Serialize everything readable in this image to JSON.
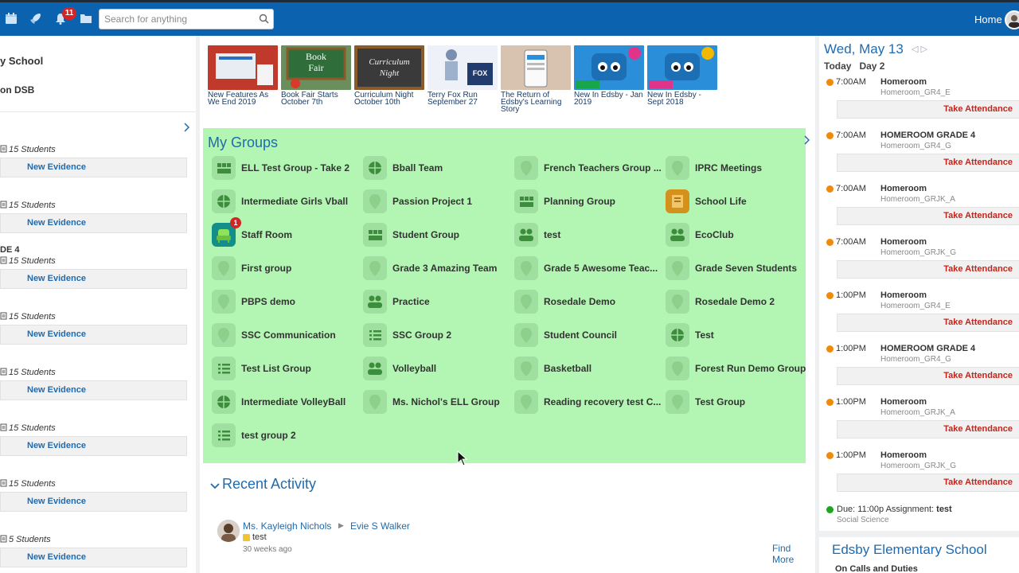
{
  "topbar": {
    "notification_count": "11",
    "search_placeholder": "Search for anything",
    "home_label": "Home"
  },
  "left": {
    "school": "y School",
    "board": "on DSB",
    "entries": [
      {
        "title": "",
        "count": "15 Students",
        "action": "New Evidence"
      },
      {
        "title": "",
        "count": "15 Students",
        "action": "New Evidence"
      },
      {
        "title": "DE 4",
        "count": "15 Students",
        "action": "New Evidence"
      },
      {
        "title": "",
        "count": "15 Students",
        "action": "New Evidence"
      },
      {
        "title": "",
        "count": "15 Students",
        "action": "New Evidence"
      },
      {
        "title": "",
        "count": "15 Students",
        "action": "New Evidence"
      },
      {
        "title": "",
        "count": "15 Students",
        "action": "New Evidence"
      },
      {
        "title": "",
        "count": "5 Students",
        "action": "New Evidence"
      }
    ]
  },
  "news": [
    {
      "caption": "New Features As We End 2019",
      "thumb": "features",
      "color": "#c0392b"
    },
    {
      "caption": "Book Fair Starts October 7th",
      "thumb": "bookfair",
      "color": "#2f6e3a"
    },
    {
      "caption": "Curriculum Night October 10th",
      "thumb": "curriculum",
      "color": "#3a3a3a"
    },
    {
      "caption": "Terry Fox Run September 27",
      "thumb": "terryfox",
      "color": "#233c6e"
    },
    {
      "caption": "The Return of Edsby's Learning Story",
      "thumb": "phone",
      "color": "#d8c3b0"
    },
    {
      "caption": "New In Edsby - Jan 2019",
      "thumb": "robot-jan",
      "color": "#2a8ed8"
    },
    {
      "caption": "New In Edsby - Sept 2018",
      "thumb": "robot-sept",
      "color": "#2a8ed8"
    }
  ],
  "groups": {
    "title": "My Groups",
    "find_more": "Find More",
    "items": [
      {
        "name": "ELL Test Group - Take 2",
        "icon": "group-icon"
      },
      {
        "name": "Bball Team",
        "icon": "ball-icon"
      },
      {
        "name": "French Teachers Group ...",
        "icon": "pin-icon"
      },
      {
        "name": "IPRC Meetings",
        "icon": "pin-icon"
      },
      {
        "name": "Intermediate Girls Vball",
        "icon": "ball-icon"
      },
      {
        "name": "Passion Project 1",
        "icon": "pin-icon"
      },
      {
        "name": "Planning Group",
        "icon": "group-icon"
      },
      {
        "name": "School Life",
        "icon": "book-icon"
      },
      {
        "name": "Staff Room",
        "icon": "chair-icon",
        "badge": "1"
      },
      {
        "name": "Student Group",
        "icon": "group-icon"
      },
      {
        "name": "test",
        "icon": "people-icon"
      },
      {
        "name": "EcoClub",
        "icon": "people-icon"
      },
      {
        "name": "First group",
        "icon": "pin-icon"
      },
      {
        "name": "Grade 3 Amazing Team",
        "icon": "pin-icon"
      },
      {
        "name": "Grade 5 Awesome Teac...",
        "icon": "pin-icon"
      },
      {
        "name": "Grade Seven Students",
        "icon": "pin-icon"
      },
      {
        "name": "PBPS demo",
        "icon": "pin-icon"
      },
      {
        "name": "Practice",
        "icon": "people-icon"
      },
      {
        "name": "Rosedale Demo",
        "icon": "pin-icon"
      },
      {
        "name": "Rosedale Demo 2",
        "icon": "pin-icon"
      },
      {
        "name": "SSC Communication",
        "icon": "pin-icon"
      },
      {
        "name": "SSC Group 2",
        "icon": "list-icon"
      },
      {
        "name": "Student Council",
        "icon": "pin-icon"
      },
      {
        "name": "Test",
        "icon": "ball-icon"
      },
      {
        "name": "Test List Group",
        "icon": "list-icon"
      },
      {
        "name": "Volleyball",
        "icon": "people-icon"
      },
      {
        "name": "Basketball",
        "icon": "pin-icon"
      },
      {
        "name": "Forest Run Demo Group",
        "icon": "pin-icon"
      },
      {
        "name": "Intermediate VolleyBall",
        "icon": "ball-icon"
      },
      {
        "name": "Ms. Nichol's ELL Group",
        "icon": "pin-icon"
      },
      {
        "name": "Reading recovery test C...",
        "icon": "pin-icon"
      },
      {
        "name": "Test Group",
        "icon": "pin-icon"
      },
      {
        "name": "test group 2",
        "icon": "list-icon"
      }
    ]
  },
  "recent": {
    "title": "Recent Activity",
    "author": "Ms. Kayleigh Nichols",
    "target": "Evie S Walker",
    "note": "test",
    "time": "30 weeks ago"
  },
  "calendar": {
    "date_title": "Wed, May 13",
    "today_label": "Today",
    "day_label": "Day 2",
    "events": [
      {
        "time": "7:00AM",
        "name": "Homeroom",
        "sub": "Homeroom_GR4_E",
        "action": "Take Attendance"
      },
      {
        "time": "7:00AM",
        "name": "HOMEROOM GRADE 4",
        "sub": "Homeroom_GR4_G",
        "action": "Take Attendance"
      },
      {
        "time": "7:00AM",
        "name": "Homeroom",
        "sub": "Homeroom_GRJK_A",
        "action": "Take Attendance"
      },
      {
        "time": "7:00AM",
        "name": "Homeroom",
        "sub": "Homeroom_GRJK_G",
        "action": "Take Attendance"
      },
      {
        "time": "1:00PM",
        "name": "Homeroom",
        "sub": "Homeroom_GR4_E",
        "action": "Take Attendance"
      },
      {
        "time": "1:00PM",
        "name": "HOMEROOM GRADE 4",
        "sub": "Homeroom_GR4_G",
        "action": "Take Attendance"
      },
      {
        "time": "1:00PM",
        "name": "Homeroom",
        "sub": "Homeroom_GRJK_A",
        "action": "Take Attendance"
      },
      {
        "time": "1:00PM",
        "name": "Homeroom",
        "sub": "Homeroom_GRJK_G",
        "action": "Take Attendance"
      }
    ],
    "due_text": "Due: 11:00p Assignment: ",
    "due_name": "test",
    "due_sub": "Social Science",
    "school_title": "Edsby Elementary School",
    "section_label": "On Calls and Duties"
  },
  "colors": {
    "topbar": "#0b63b0",
    "accent": "#1e6bb0",
    "groups_bg": "#b3f5b3",
    "attendance": "#c0261d",
    "event_dot": "#f08a0a",
    "due_dot": "#1ea51e"
  }
}
